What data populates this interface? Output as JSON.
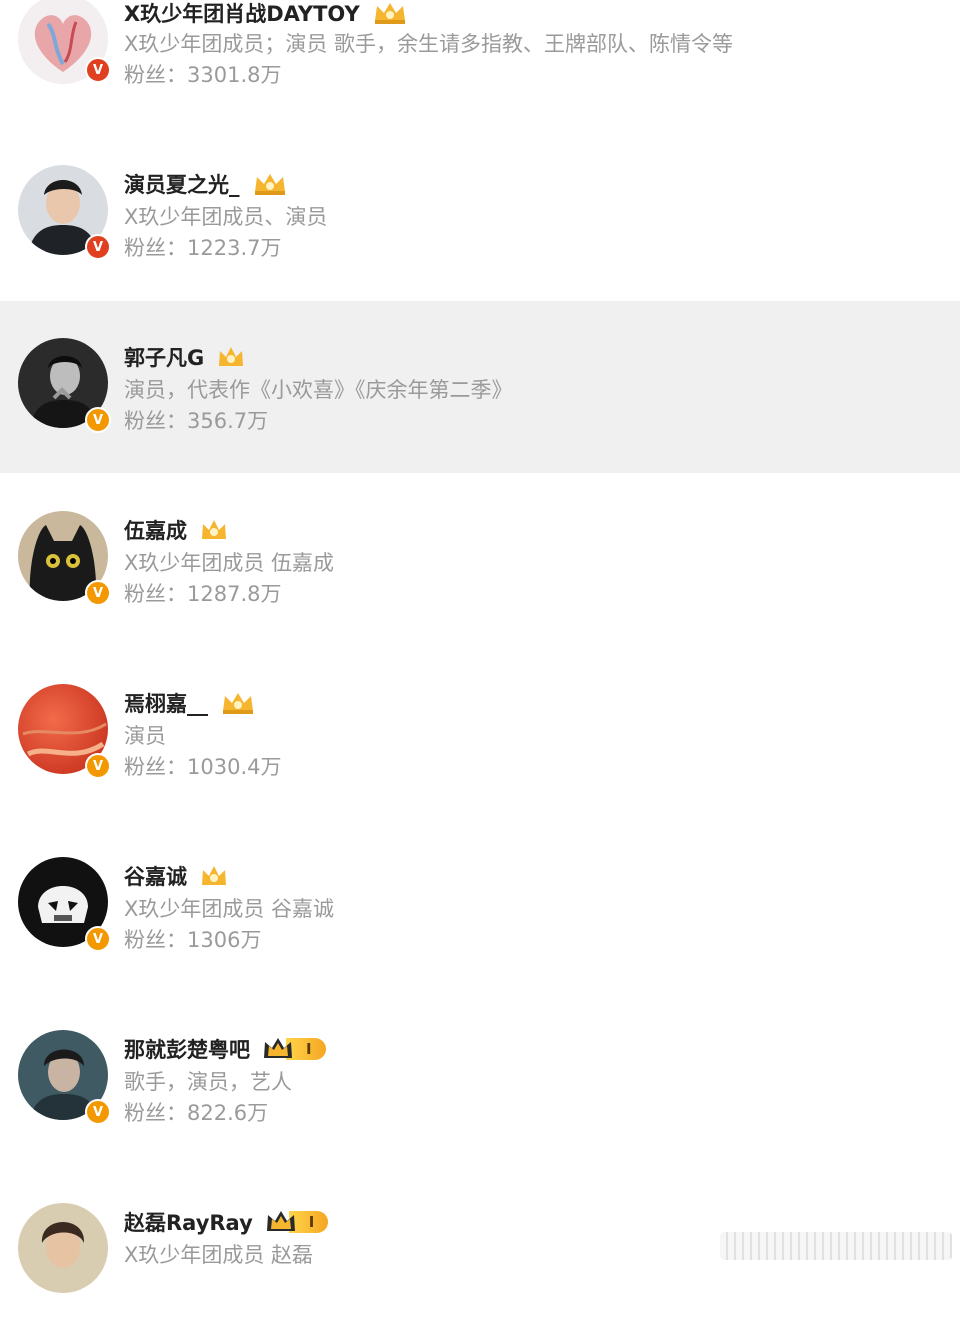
{
  "users": [
    {
      "name": "X玖少年团肖战DAYTOY",
      "desc": "X玖少年团成员；演员 歌手，余生请多指教、王牌部队、陈情令等",
      "fans": "粉丝：3301.8万",
      "crown": "gold-crown-icon",
      "avatar": "heart-art"
    },
    {
      "name": "演员夏之光_",
      "desc": "X玖少年团成员、演员",
      "fans": "粉丝：1223.7万",
      "crown": "gold-crown-icon",
      "avatar": "portrait-light"
    },
    {
      "name": "郭子凡G",
      "desc": "演员，代表作《小欢喜》《庆余年第二季》",
      "fans": "粉丝：356.7万",
      "crown": "gold-crown-icon",
      "avatar": "portrait-bw"
    },
    {
      "name": "伍嘉成",
      "desc": "X玖少年团成员 伍嘉成",
      "fans": "粉丝：1287.8万",
      "crown": "gold-crown-icon",
      "avatar": "black-cat"
    },
    {
      "name": "焉栩嘉__",
      "desc": "演员",
      "fans": "粉丝：1030.4万",
      "crown": "gold-crown-icon",
      "avatar": "red-art"
    },
    {
      "name": "谷嘉诚",
      "desc": "X玖少年团成员 谷嘉诚",
      "fans": "粉丝：1306万",
      "crown": "gold-crown-icon",
      "avatar": "stormtrooper"
    },
    {
      "name": "那就彭楚粤吧",
      "desc": "歌手，演员，艺人",
      "fans": "粉丝：822.6万",
      "crown": "level-badge-icon",
      "level": "I",
      "avatar": "portrait-dark"
    },
    {
      "name": "赵磊RayRay",
      "desc": "X玖少年团成员 赵磊",
      "fans": "",
      "crown": "level-badge-icon",
      "level": "I",
      "avatar": "portrait-warm"
    }
  ],
  "verified_label": "V",
  "colors": {
    "verified_red": "#e0401f",
    "verified_orange": "#f39800",
    "crown_gold": "#f5b52e",
    "highlight_bg": "#f0f0f0"
  }
}
